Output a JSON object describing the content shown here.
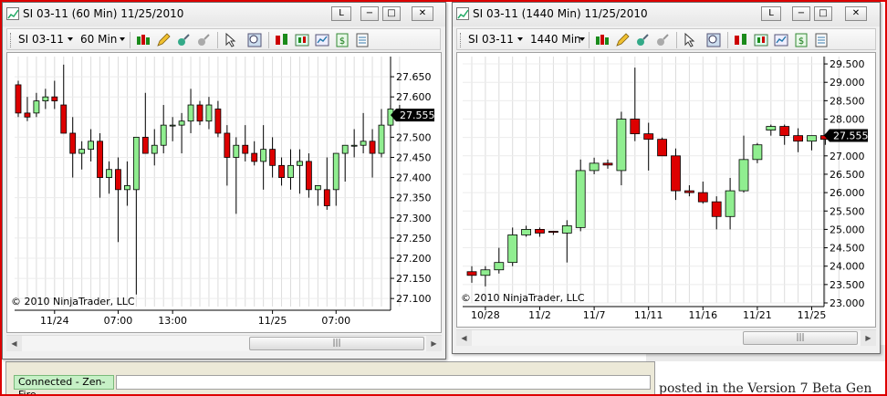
{
  "background": {
    "partial_text": "posted in the Version 7 Beta Gen"
  },
  "host_status": {
    "connection": "Connected - Zen-Fire"
  },
  "windows": [
    {
      "title": "SI 03-11 (60 Min)  11/25/2010",
      "instrument": "SI 03-11",
      "interval": "60 Min",
      "caption_buttons": [
        "L",
        "−",
        "□",
        "✕"
      ],
      "copyright": "© 2010 NinjaTrader, LLC",
      "last_price": "27.555",
      "chart_data": {
        "type": "candlestick",
        "ylim": [
          27.08,
          27.7
        ],
        "y_ticks": [
          "27.650",
          "27.600",
          "27.550",
          "27.500",
          "27.450",
          "27.400",
          "27.350",
          "27.300",
          "27.250",
          "27.200",
          "27.150",
          "27.100"
        ],
        "x_ticks": [
          {
            "label": "11/24",
            "index": 4
          },
          {
            "label": "07:00",
            "index": 11
          },
          {
            "label": "13:00",
            "index": 17
          },
          {
            "label": "11/25",
            "index": 28
          },
          {
            "label": "07:00",
            "index": 35
          }
        ],
        "ohlc": [
          [
            27.63,
            27.64,
            27.55,
            27.56
          ],
          [
            27.56,
            27.6,
            27.54,
            27.55
          ],
          [
            27.56,
            27.61,
            27.55,
            27.59
          ],
          [
            27.59,
            27.62,
            27.57,
            27.6
          ],
          [
            27.6,
            27.64,
            27.57,
            27.59
          ],
          [
            27.58,
            27.68,
            27.51,
            27.51
          ],
          [
            27.51,
            27.55,
            27.4,
            27.46
          ],
          [
            27.46,
            27.49,
            27.42,
            27.47
          ],
          [
            27.47,
            27.52,
            27.44,
            27.49
          ],
          [
            27.49,
            27.51,
            27.35,
            27.4
          ],
          [
            27.4,
            27.44,
            27.36,
            27.42
          ],
          [
            27.42,
            27.45,
            27.24,
            27.37
          ],
          [
            27.37,
            27.44,
            27.33,
            27.38
          ],
          [
            27.37,
            27.49,
            27.11,
            27.5
          ],
          [
            27.5,
            27.61,
            27.47,
            27.46
          ],
          [
            27.46,
            27.52,
            27.43,
            27.48
          ],
          [
            27.48,
            27.58,
            27.46,
            27.53
          ],
          [
            27.53,
            27.55,
            27.49,
            27.53
          ],
          [
            27.53,
            27.56,
            27.46,
            27.54
          ],
          [
            27.54,
            27.62,
            27.51,
            27.58
          ],
          [
            27.58,
            27.59,
            27.53,
            27.54
          ],
          [
            27.54,
            27.6,
            27.52,
            27.58
          ],
          [
            27.57,
            27.59,
            27.5,
            27.51
          ],
          [
            27.51,
            27.53,
            27.38,
            27.45
          ],
          [
            27.45,
            27.5,
            27.31,
            27.48
          ],
          [
            27.48,
            27.53,
            27.44,
            27.46
          ],
          [
            27.46,
            27.49,
            27.43,
            27.44
          ],
          [
            27.44,
            27.53,
            27.37,
            27.47
          ],
          [
            27.47,
            27.5,
            27.4,
            27.43
          ],
          [
            27.43,
            27.45,
            27.38,
            27.4
          ],
          [
            27.4,
            27.47,
            27.37,
            27.43
          ],
          [
            27.43,
            27.47,
            27.36,
            27.44
          ],
          [
            27.44,
            27.46,
            27.35,
            27.37
          ],
          [
            27.37,
            27.38,
            27.33,
            27.38
          ],
          [
            27.37,
            27.45,
            27.32,
            27.33
          ],
          [
            27.37,
            27.46,
            27.33,
            27.46
          ],
          [
            27.46,
            27.48,
            27.39,
            27.48
          ],
          [
            27.48,
            27.52,
            27.45,
            27.48
          ],
          [
            27.48,
            27.56,
            27.46,
            27.49
          ],
          [
            27.49,
            27.52,
            27.4,
            27.46
          ],
          [
            27.46,
            27.57,
            27.45,
            27.53
          ],
          [
            27.53,
            27.58,
            27.51,
            27.57
          ],
          [
            27.57,
            27.58,
            27.55,
            27.56
          ]
        ],
        "up_color": "#90ee90",
        "down_color": "#dd0000"
      }
    },
    {
      "title": "SI 03-11 (1440 Min)  11/25/2010",
      "instrument": "SI 03-11",
      "interval": "1440 Min",
      "caption_buttons": [
        "L",
        "−",
        "□",
        "✕"
      ],
      "copyright": "© 2010 NinjaTrader, LLC",
      "last_price": "27.555",
      "chart_data": {
        "type": "candlestick",
        "ylim": [
          23.0,
          29.7
        ],
        "y_ticks": [
          "29.500",
          "29.000",
          "28.500",
          "28.000",
          "27.500",
          "27.000",
          "26.500",
          "26.000",
          "25.500",
          "25.000",
          "24.500",
          "24.000",
          "23.500",
          "23.000"
        ],
        "x_ticks": [
          {
            "label": "10/28",
            "index": 1
          },
          {
            "label": "11/2",
            "index": 5
          },
          {
            "label": "11/7",
            "index": 9
          },
          {
            "label": "11/11",
            "index": 13
          },
          {
            "label": "11/16",
            "index": 17
          },
          {
            "label": "11/21",
            "index": 21
          },
          {
            "label": "11/25",
            "index": 25
          }
        ],
        "ohlc": [
          [
            23.85,
            24.0,
            23.55,
            23.75
          ],
          [
            23.75,
            24.0,
            23.45,
            23.9
          ],
          [
            23.9,
            24.5,
            23.8,
            24.1
          ],
          [
            24.1,
            25.05,
            24.0,
            24.85
          ],
          [
            24.85,
            25.1,
            24.8,
            25.0
          ],
          [
            25.0,
            25.05,
            24.8,
            24.9
          ],
          [
            24.95,
            24.95,
            24.85,
            24.92
          ],
          [
            24.9,
            25.25,
            24.1,
            25.1
          ],
          [
            25.05,
            26.9,
            24.95,
            26.6
          ],
          [
            26.6,
            26.95,
            26.5,
            26.8
          ],
          [
            26.8,
            26.9,
            26.65,
            26.75
          ],
          [
            26.6,
            28.2,
            26.2,
            28.0
          ],
          [
            28.0,
            29.4,
            27.4,
            27.6
          ],
          [
            27.6,
            27.9,
            26.6,
            27.45
          ],
          [
            27.45,
            27.5,
            27.0,
            27.0
          ],
          [
            27.0,
            27.2,
            25.8,
            26.05
          ],
          [
            26.05,
            26.2,
            25.9,
            26.0
          ],
          [
            26.0,
            26.3,
            25.7,
            25.75
          ],
          [
            25.75,
            25.9,
            25.0,
            25.35
          ],
          [
            25.35,
            26.4,
            25.0,
            26.05
          ],
          [
            26.05,
            27.55,
            26.0,
            26.9
          ],
          [
            26.9,
            27.35,
            26.8,
            27.3
          ],
          [
            27.7,
            27.85,
            27.55,
            27.8
          ],
          [
            27.8,
            27.85,
            27.3,
            27.55
          ],
          [
            27.55,
            27.75,
            27.1,
            27.4
          ],
          [
            27.4,
            27.55,
            27.15,
            27.55
          ],
          [
            27.55,
            27.6,
            27.3,
            27.45
          ],
          [
            27.45,
            27.58,
            27.4,
            27.56
          ]
        ],
        "up_color": "#90ee90",
        "down_color": "#dd0000"
      }
    }
  ]
}
